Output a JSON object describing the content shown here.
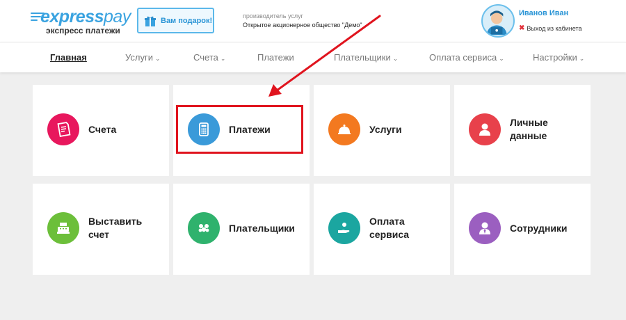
{
  "header": {
    "logo_bold": "express",
    "logo_light": "pay",
    "logo_sub": "экспресс платежи",
    "gift_button": "Вам подарок!",
    "provider_label": "производитель услуг",
    "provider_name": "Открытое акционерное общество \"Демо\"",
    "user_name": "Иванов Иван",
    "logout": "Выход из кабинета"
  },
  "nav": {
    "items": [
      {
        "label": "Главная",
        "active": true,
        "dropdown": false
      },
      {
        "label": "Услуги",
        "dropdown": true
      },
      {
        "label": "Счета",
        "dropdown": true
      },
      {
        "label": "Платежи",
        "dropdown": false
      },
      {
        "label": "Плательщики",
        "dropdown": true
      },
      {
        "label": "Оплата сервиса",
        "dropdown": true
      },
      {
        "label": "Настройки",
        "dropdown": true
      }
    ],
    "chevron": "⌄"
  },
  "tiles": [
    {
      "label1": "Счета",
      "label2": "",
      "icon": "invoice-icon",
      "color": "#e8175d"
    },
    {
      "label1": "Платежи",
      "label2": "",
      "icon": "calculator-icon",
      "color": "#3a9ad9"
    },
    {
      "label1": "Услуги",
      "label2": "",
      "icon": "cloche-icon",
      "color": "#f37920"
    },
    {
      "label1": "Личные",
      "label2": "данные",
      "icon": "user-icon",
      "color": "#e8414b"
    },
    {
      "label1": "Выставить",
      "label2": "счет",
      "icon": "cash-register-icon",
      "color": "#6cbf3a"
    },
    {
      "label1": "Плательщики",
      "label2": "",
      "icon": "group-icon",
      "color": "#2fb26d"
    },
    {
      "label1": "Оплата",
      "label2": "сервиса",
      "icon": "hand-coin-icon",
      "color": "#1ba6a0"
    },
    {
      "label1": "Сотрудники",
      "label2": "",
      "icon": "employee-icon",
      "color": "#9b5fc0"
    }
  ],
  "colors": {
    "brand": "#3aa3e0",
    "highlight": "#e0141e"
  }
}
